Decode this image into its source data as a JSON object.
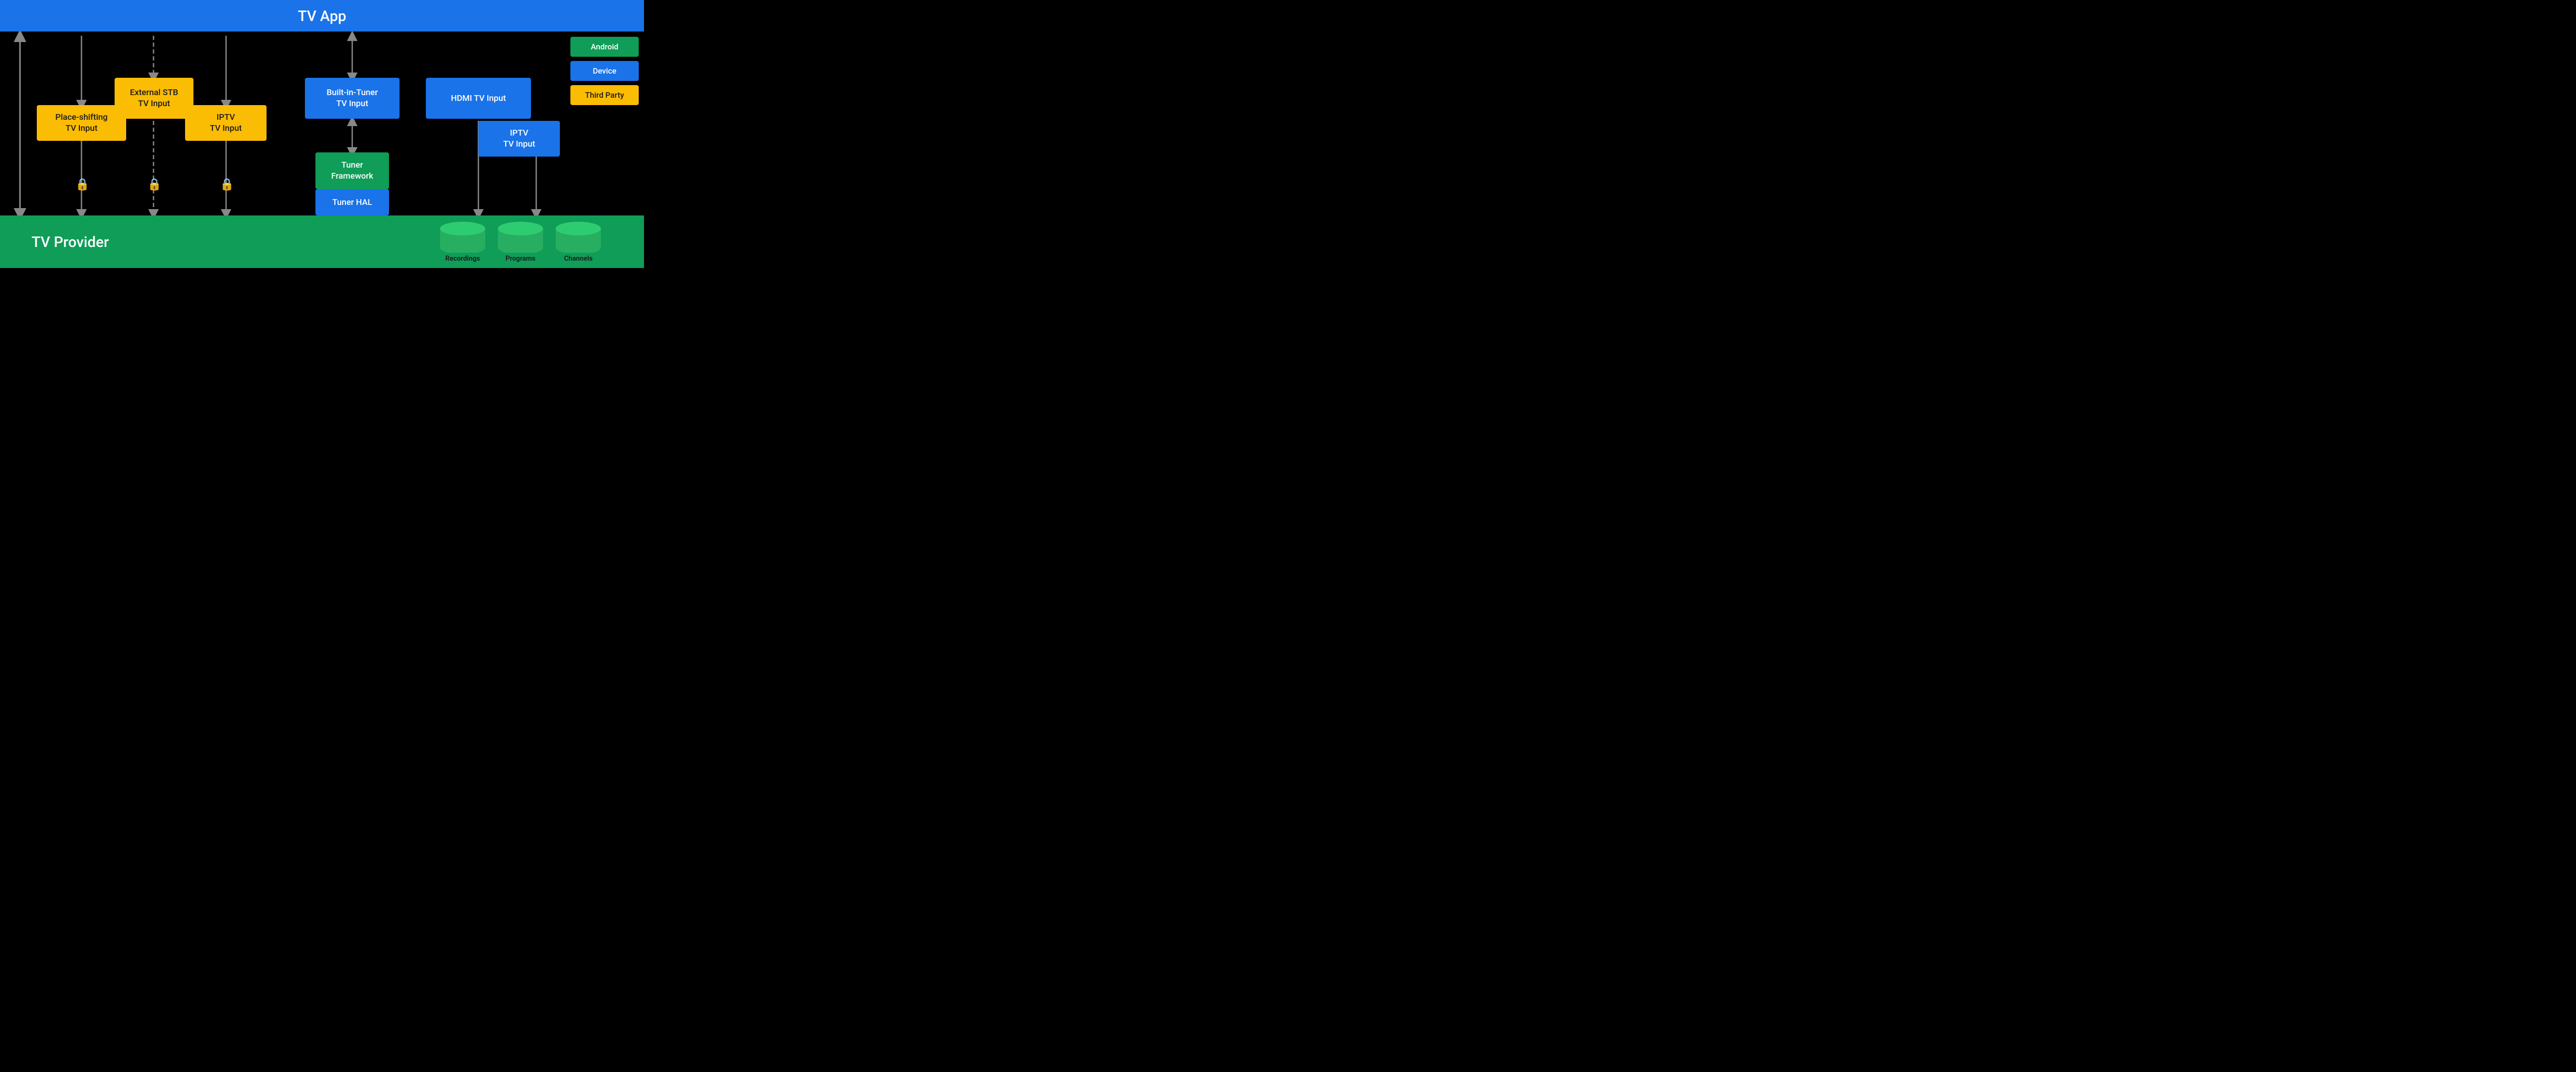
{
  "header": {
    "title": "TV App",
    "bg": "#1a73e8"
  },
  "footer": {
    "title": "TV Provider",
    "bg": "#0f9d58"
  },
  "legend": {
    "items": [
      {
        "label": "Android",
        "color": "#0f9d58",
        "text_color": "white"
      },
      {
        "label": "Device",
        "color": "#1a73e8",
        "text_color": "white"
      },
      {
        "label": "Third Party",
        "color": "#fbbc04",
        "text_color": "#1a1a1a"
      }
    ]
  },
  "boxes": [
    {
      "id": "place-shifting",
      "label": "Place-shifting\nTV Input",
      "type": "orange"
    },
    {
      "id": "external-stb",
      "label": "External STB\nTV Input",
      "type": "orange"
    },
    {
      "id": "iptv-left",
      "label": "IPTV\nTV Input",
      "type": "orange"
    },
    {
      "id": "builtin-tuner",
      "label": "Built-in-Tuner\nTV Input",
      "type": "blue"
    },
    {
      "id": "tuner-framework",
      "label": "Tuner\nFramework",
      "type": "green"
    },
    {
      "id": "tuner-hal",
      "label": "Tuner HAL",
      "type": "blue"
    },
    {
      "id": "hdmi-tv-input",
      "label": "HDMI TV Input",
      "type": "blue"
    },
    {
      "id": "iptv-right",
      "label": "IPTV\nTV Input",
      "type": "blue"
    }
  ],
  "databases": [
    {
      "id": "recordings",
      "label": "Recordings"
    },
    {
      "id": "programs",
      "label": "Programs"
    },
    {
      "id": "channels",
      "label": "Channels"
    }
  ]
}
